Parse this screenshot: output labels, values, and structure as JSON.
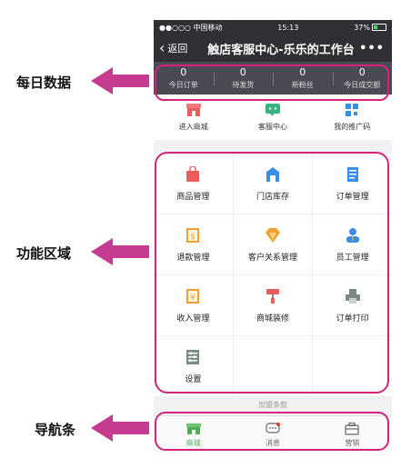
{
  "annotations": {
    "daily_data": "每日数据",
    "function_area": "功能区域",
    "nav_bar": "导航条",
    "color": "#c43b8f"
  },
  "status_bar": {
    "carrier": "●●○○○ 中国移动",
    "time": "15:13",
    "battery": "37%"
  },
  "header": {
    "back_label": "返回",
    "title": "触店客服中心-乐乐的工作台",
    "more": "•••"
  },
  "stats": [
    {
      "value": "0",
      "label": "今日订单"
    },
    {
      "value": "0",
      "label": "待发货"
    },
    {
      "value": "0",
      "label": "新粉丝"
    },
    {
      "value": "0",
      "label": "今日成交额"
    }
  ],
  "quick_links": [
    {
      "label": "进入商城",
      "icon": "store-icon"
    },
    {
      "label": "客服中心",
      "icon": "chat-icon"
    },
    {
      "label": "我的推广码",
      "icon": "qr-code-icon"
    }
  ],
  "grid_items": [
    {
      "label": "商品管理",
      "icon": "bag-icon",
      "color": "#e95d5d"
    },
    {
      "label": "门店库存",
      "icon": "warehouse-icon",
      "color": "#3a8ee6"
    },
    {
      "label": "订单管理",
      "icon": "document-icon",
      "color": "#3a8ee6"
    },
    {
      "label": "退款管理",
      "icon": "refund-icon",
      "color": "#f0a030"
    },
    {
      "label": "客户关系管理",
      "icon": "diamond-icon",
      "color": "#f0a030"
    },
    {
      "label": "员工管理",
      "icon": "staff-icon",
      "color": "#3a8ee6"
    },
    {
      "label": "收入管理",
      "icon": "income-icon",
      "color": "#f0a030"
    },
    {
      "label": "商城装修",
      "icon": "paint-roller-icon",
      "color": "#e95d5d"
    },
    {
      "label": "订单打印",
      "icon": "printer-icon",
      "color": "#7a8a80"
    },
    {
      "label": "设置",
      "icon": "settings-icon",
      "color": "#7a8a80"
    }
  ],
  "more_section": "加盟条款",
  "tabs": [
    {
      "label": "商城",
      "icon": "shop-icon",
      "active": true
    },
    {
      "label": "消息",
      "icon": "message-icon",
      "active": false
    },
    {
      "label": "营销",
      "icon": "marketing-icon",
      "active": false
    }
  ],
  "accent": "#4caf50",
  "highlight": "#d4237a"
}
